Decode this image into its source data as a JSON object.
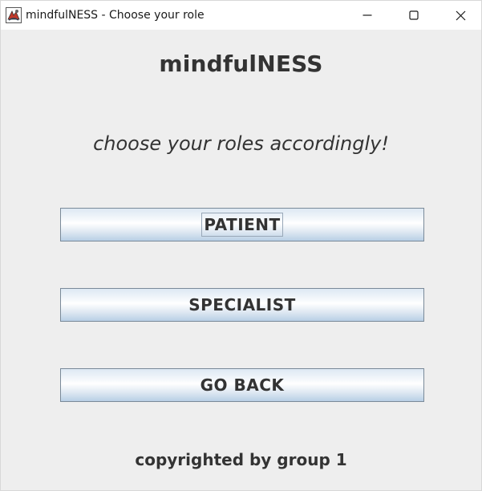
{
  "window": {
    "title": "mindfulNESS - Choose your role",
    "app_icon": "java-app-icon",
    "controls": {
      "minimize_icon": "minimize-icon",
      "maximize_icon": "maximize-icon",
      "close_icon": "close-icon"
    }
  },
  "main": {
    "heading": "mindfulNESS",
    "subheading": "choose your roles accordingly!",
    "buttons": {
      "patient_label": "PATIENT",
      "specialist_label": "SPECIALIST",
      "go_back_label": "GO BACK"
    },
    "footer": "copyrighted by group 1"
  },
  "colors": {
    "background": "#eeeeee",
    "titlebar": "#ffffff",
    "text": "#333333",
    "button_border": "#7a8a99",
    "button_gradient_bottom": "#b8cfe5"
  }
}
